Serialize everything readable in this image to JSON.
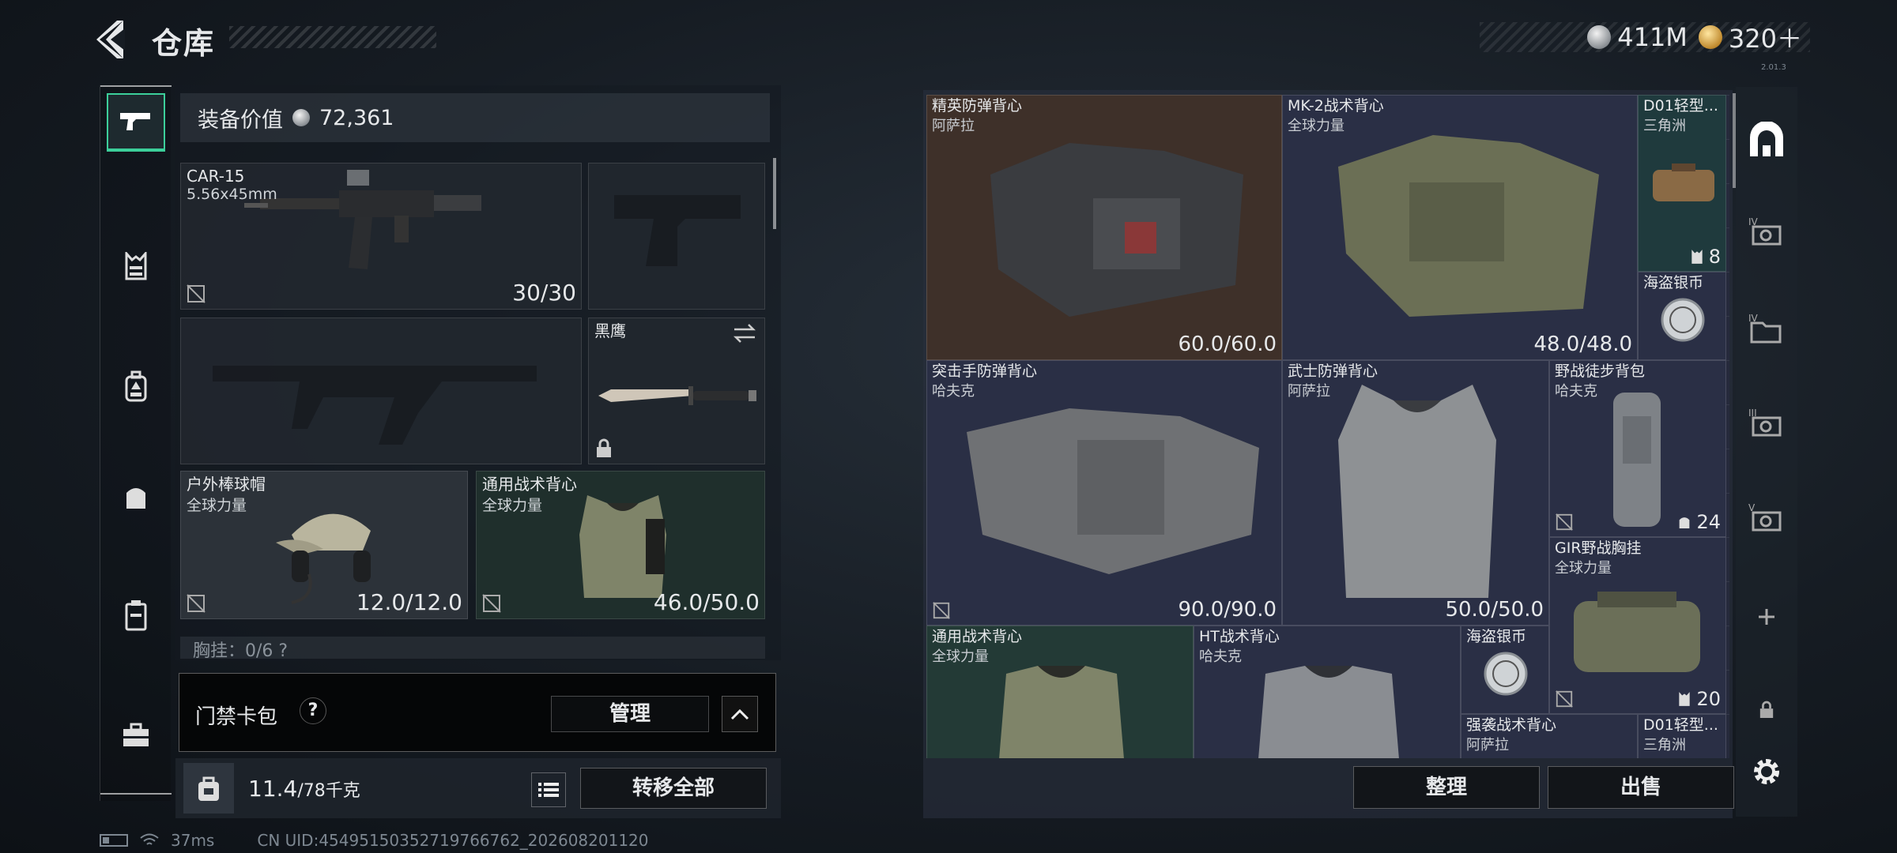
{
  "header": {
    "title": "仓库",
    "currencies": [
      {
        "icon": "silver-coin-icon",
        "value": "411M"
      },
      {
        "icon": "gold-coin-icon",
        "value": "320＋"
      }
    ],
    "version": "2.01.3"
  },
  "equipment": {
    "value_label": "装备价值",
    "value": "72,361",
    "slots": {
      "primary": {
        "name": "CAR-15",
        "sub": "5.56x45mm",
        "ammo": "30/30"
      },
      "melee": {
        "name": "黑鹰"
      },
      "helmet": {
        "name": "户外棒球帽",
        "sub": "全球力量",
        "durability": "12.0/12.0"
      },
      "armor": {
        "name": "通用战术背心",
        "sub": "全球力量",
        "durability": "46.0/50.0"
      }
    },
    "chest_rig_label": "胸挂：0/6 ?"
  },
  "keycard": {
    "label": "门禁卡包",
    "help": "?",
    "manage": "管理"
  },
  "bag": {
    "weight": "11.4",
    "max": "/78千克",
    "transfer_all": "转移全部"
  },
  "status": {
    "ping": "37ms",
    "uid": "CN UID:4549515035271976​6762_202608201120"
  },
  "stash": {
    "items": [
      {
        "id": "elite-vest",
        "name": "精英防弹背心",
        "sub": "阿萨拉",
        "value": "60.0/60.0"
      },
      {
        "id": "mk2-vest",
        "name": "MK-2战术背心",
        "sub": "全球力量",
        "value": "48.0/48.0"
      },
      {
        "id": "d01-a",
        "name": "D01轻型...",
        "sub": "三角洲",
        "count": "8"
      },
      {
        "id": "pirate-coin-a",
        "name": "海盗银币"
      },
      {
        "id": "assault-vest",
        "name": "突击手防弹背心",
        "sub": "哈夫克",
        "value": "90.0/90.0"
      },
      {
        "id": "warrior-vest",
        "name": "武士防弹背心",
        "sub": "阿萨拉",
        "value": "50.0/50.0"
      },
      {
        "id": "field-pack",
        "name": "野战徒步背包",
        "sub": "哈夫克",
        "count": "24"
      },
      {
        "id": "gir-rig",
        "name": "GIR野战胸挂",
        "sub": "全球力量",
        "count": "20"
      },
      {
        "id": "general-vest",
        "name": "通用战术背心",
        "sub": "全球力量"
      },
      {
        "id": "ht-vest",
        "name": "HT战术背心",
        "sub": "哈夫克"
      },
      {
        "id": "pirate-coin-b",
        "name": "海盗银币"
      },
      {
        "id": "raid-vest",
        "name": "强袭战术背心",
        "sub": "阿萨拉"
      },
      {
        "id": "d01-b",
        "name": "D01轻型...",
        "sub": "三角洲"
      }
    ],
    "sort": "整理",
    "sell": "出售"
  },
  "colors": {
    "accent": "#3ccf9a"
  }
}
